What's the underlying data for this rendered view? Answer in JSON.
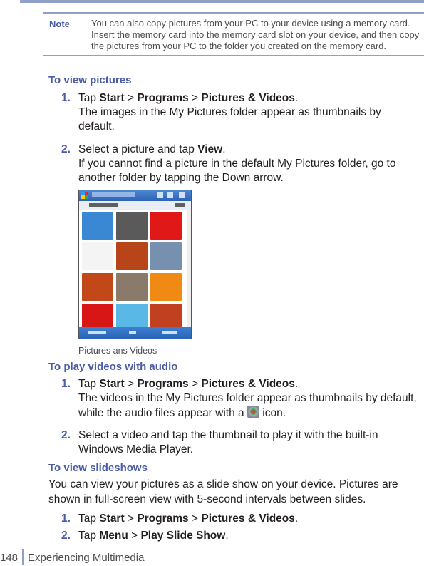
{
  "note": {
    "label": "Note",
    "text": "You can also copy pictures from your PC to your device using a memory card. Insert the memory card into the memory card slot on your device, and then copy the pictures from your PC to the folder you created on the memory card."
  },
  "sections": {
    "view_pictures": {
      "heading": "To view pictures",
      "steps": [
        {
          "num": "1.",
          "pre": "Tap ",
          "b1": "Start",
          "sep1": " > ",
          "b2": "Programs",
          "sep2": " > ",
          "b3": "Pictures & Videos",
          "post": ".",
          "detail": "The images in the My Pictures folder appear as thumbnails by default."
        },
        {
          "num": "2.",
          "pre": "Select a picture and tap ",
          "b1": "View",
          "post": ".",
          "detail": "If you cannot find a picture in the default My Pictures folder, go to another folder by tapping the Down arrow."
        }
      ]
    },
    "screenshot": {
      "caption": "Pictures ans Videos",
      "thumbnail_colors": [
        "#3a87d4",
        "#5a5a5a",
        "#e01818",
        "#f4f4f4",
        "#b8441a",
        "#7890b0",
        "#c2481a",
        "#8a7a6a",
        "#f08a14",
        "#d81616",
        "#5ab8e6",
        "#c04020"
      ]
    },
    "play_videos": {
      "heading": "To play videos with audio",
      "steps": [
        {
          "num": "1.",
          "pre": "Tap ",
          "b1": "Start",
          "sep1": " > ",
          "b2": "Programs",
          "sep2": " > ",
          "b3": "Pictures & Videos",
          "post": ".",
          "detail_a": "The videos in the My Pictures folder appear as thumbnails by default, while the audio files appear with a ",
          "detail_b": " icon."
        },
        {
          "num": "2.",
          "text": "Select a video and tap the thumbnail to play it with the built-in Windows Media Player."
        }
      ]
    },
    "slideshows": {
      "heading": "To view slideshows",
      "intro": "You can view your pictures as a slide show on your device. Pictures are shown in full-screen view with 5-second intervals between slides.",
      "steps": [
        {
          "num": "1.",
          "pre": "Tap ",
          "b1": "Start",
          "sep1": " > ",
          "b2": "Programs",
          "sep2": " > ",
          "b3": "Pictures & Videos",
          "post": "."
        },
        {
          "num": "2.",
          "pre": "Tap ",
          "b1": "Menu",
          "sep1": " > ",
          "b2": "Play Slide Show",
          "post": "."
        }
      ]
    }
  },
  "footer": {
    "page_number": "148",
    "chapter": "Experiencing Multimedia"
  }
}
